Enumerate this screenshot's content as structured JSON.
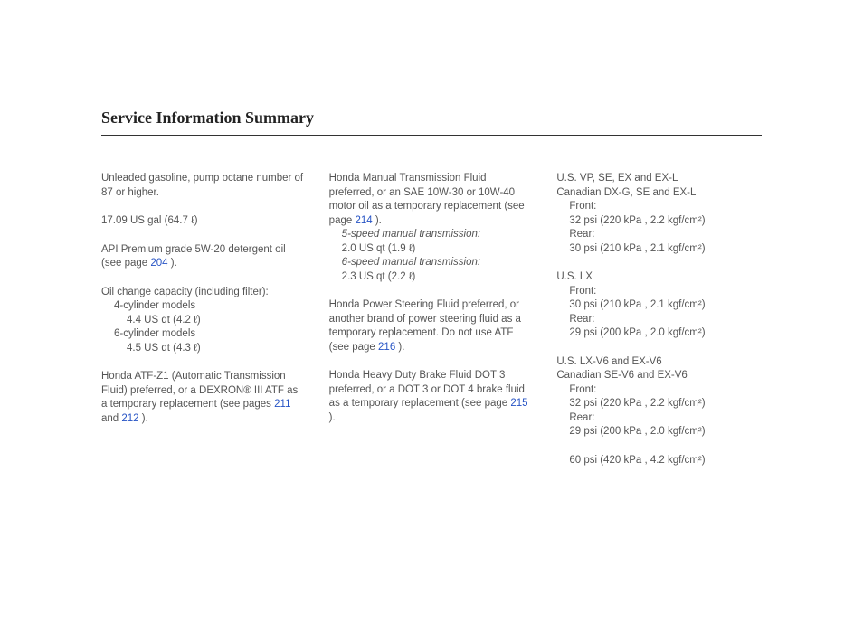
{
  "title": "Service Information Summary",
  "col1": {
    "fuel": "Unleaded gasoline, pump octane number of 87 or higher.",
    "tank": "17.09 US gal (64.7 ℓ)",
    "oil_pre": "API Premium grade 5W-20 detergent oil (see page ",
    "oil_link": "204",
    "oil_post": " ).",
    "oilcap_header": "Oil change capacity (including filter):",
    "cyl4_lbl": "4-cylinder models",
    "cyl4_val": "4.4 US qt (4.2 ℓ)",
    "cyl6_lbl": "6-cylinder models",
    "cyl6_val": "4.5 US qt (4.3 ℓ)",
    "atf_pre": "Honda ATF-Z1 (Automatic Transmission Fluid) preferred, or a DEXRON® III ATF as a temporary replacement (see pages ",
    "atf_link1": "211",
    "atf_mid": " and ",
    "atf_link2": "212",
    "atf_post": " )."
  },
  "col2": {
    "mtf_pre": "Honda Manual Transmission Fluid preferred, or an SAE 10W-30 or 10W-40 motor oil as a temporary replacement (see page ",
    "mtf_link": "214",
    "mtf_post": " ).",
    "speed5_lbl": "5-speed manual transmission:",
    "speed5_val": "2.0 US qt (1.9 ℓ)",
    "speed6_lbl": "6-speed manual transmission:",
    "speed6_val": "2.3 US qt (2.2 ℓ)",
    "psf_pre": "Honda Power Steering Fluid preferred, or another brand of power steering fluid as a temporary replacement. Do not use ATF (see page ",
    "psf_link": "216",
    "psf_post": " ).",
    "brake_pre": "Honda Heavy Duty Brake Fluid DOT 3 preferred, or a DOT 3 or DOT 4 brake fluid as a temporary replacement (see page ",
    "brake_link": "215",
    "brake_post": " )."
  },
  "col3": {
    "g1_l1": "U.S. VP, SE, EX and EX-L",
    "g1_l2": "Canadian DX-G, SE and EX-L",
    "g1_front_lbl": "Front:",
    "g1_front_val": "32 psi (220 kPa , 2.2 kgf/cm²)",
    "g1_rear_lbl": "Rear:",
    "g1_rear_val": "30 psi (210 kPa , 2.1 kgf/cm²)",
    "g2_l1": "U.S. LX",
    "g2_front_lbl": "Front:",
    "g2_front_val": "30 psi (210 kPa , 2.1 kgf/cm²)",
    "g2_rear_lbl": "Rear:",
    "g2_rear_val": "29 psi (200 kPa , 2.0 kgf/cm²)",
    "g3_l1": "U.S. LX-V6 and EX-V6",
    "g3_l2": "Canadian SE-V6 and EX-V6",
    "g3_front_lbl": "Front:",
    "g3_front_val": "32 psi (220 kPa , 2.2 kgf/cm²)",
    "g3_rear_lbl": "Rear:",
    "g3_rear_val": "29 psi (200 kPa , 2.0 kgf/cm²)",
    "spare": "60 psi (420 kPa , 4.2 kgf/cm²)"
  }
}
